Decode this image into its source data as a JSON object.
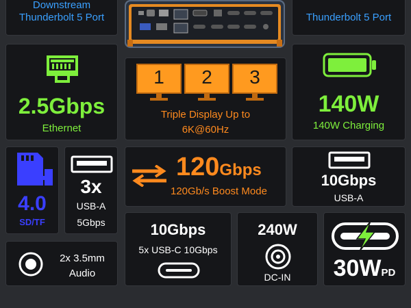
{
  "thunderbolt_left": {
    "line1": "Downstream",
    "line2": "Thunderbolt 5 Port"
  },
  "thunderbolt_right": {
    "line1": "Thunderbolt 5 Port"
  },
  "ethernet": {
    "speed": "2.5Gbps",
    "label": "Ethernet"
  },
  "display": {
    "monitors": [
      "1",
      "2",
      "3"
    ],
    "line1": "Triple Display Up to",
    "line2": "6K@60Hz"
  },
  "charging": {
    "power": "140W",
    "label": "140W Charging"
  },
  "sd_card": {
    "value": "4.0",
    "label": "SD/TF"
  },
  "usba_3x": {
    "count": "3x",
    "type": "USB-A",
    "speed": "5Gbps"
  },
  "boost": {
    "speed_num": "120",
    "speed_unit": "Gbps",
    "label": "120Gb/s Boost Mode"
  },
  "usba_10": {
    "speed": "10Gbps",
    "label": "USB-A"
  },
  "audio": {
    "line1": "2x 3.5mm",
    "line2": "Audio"
  },
  "usbc": {
    "speed": "10Gbps",
    "label": "5x USB-C 10Gbps"
  },
  "dcin": {
    "power": "240W",
    "label": "DC-IN"
  },
  "pd": {
    "power": "30W",
    "suffix": "PD"
  },
  "colors": {
    "blue": "#3aa0ff",
    "green": "#7eef3c",
    "orange": "#ff8a1e",
    "tile_bg": "#151619",
    "page_bg": "#2a2c30"
  }
}
